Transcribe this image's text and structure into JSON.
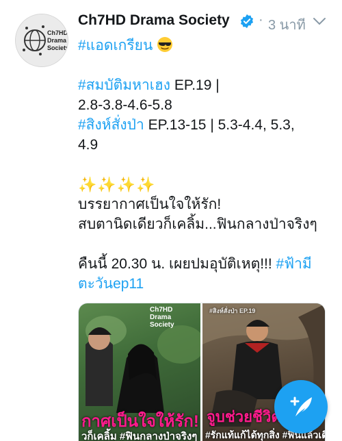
{
  "account": {
    "name": "Ch7HD Drama Society",
    "verified_icon": "verified-badge-icon",
    "time": "3 นาที",
    "avatar_text": [
      "Ch7HD",
      "Drama",
      "Society"
    ]
  },
  "tweet": {
    "line1": "#แอดเกรียน",
    "line1_emoji": "sunglasses-emoji",
    "show1_tag": "#สมบัติมหาเฮง",
    "show1_ep": " EP.19 |",
    "show1_ratings": "2.8-3.8-4.6-5.8",
    "show2_tag": "#สิงห์สั่งป่า",
    "show2_ep": "  EP.13-15 | 5.3-4.4, 5.3,",
    "show2_ratings2": "4.9",
    "sparkles": "✨✨✨✨",
    "text1": "บรรยากาศเป็นใจให้รัก!",
    "text2": "สบตานิดเดียวก็เคลิ้ม...ฟินกลางป่าจริงๆ",
    "text3": "คืนนี้ 20.30 น. เผยปมอุบัติเหตุ!!! ",
    "show3_tag_a": "#ฟ้ามี",
    "show3_tag_b": "ตะวันep11"
  },
  "media": {
    "photo1_logo": [
      "Ch7HD",
      "Drama",
      "Society"
    ],
    "photo1_caption": "กาศเป็นใจให้รัก!",
    "photo1_subcaption": "วก็เคลิ้ม #ฟินกลางป่าจริงๆ",
    "photo2_top": "#สิงห์สั่งป่า  EP.19",
    "photo2_caption": "จูบช่วยชีวิต",
    "photo2_subcaption": "#รักแท้แก้ได้ทุกสิ่ง #ฟินแล้วเดินทาง"
  },
  "compose_button": {
    "icon": "compose-tweet-icon"
  },
  "colors": {
    "link": "#1da1f2",
    "muted": "#8899a6",
    "caption_pink": "#ff1b8d"
  }
}
